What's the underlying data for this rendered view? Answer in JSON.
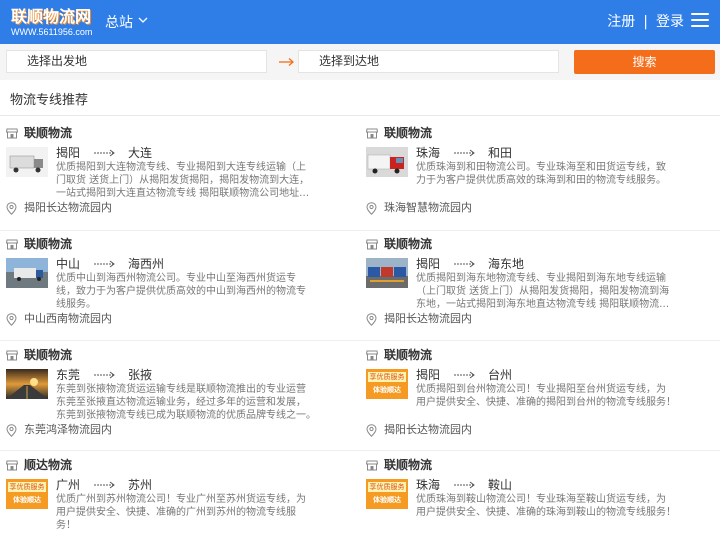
{
  "header": {
    "logo_text": "联顺物流网",
    "logo_url_text": "WWW.5611956.com",
    "station_label": "总站",
    "register_label": "注册",
    "separator": "|",
    "login_label": "登录",
    "brand_color": "#2f7ee8",
    "icons": {
      "station_chevron": "chevron-down-icon",
      "menu": "hamburger-menu-icon"
    }
  },
  "search": {
    "from_placeholder": "选择出发地",
    "to_placeholder": "选择到达地",
    "button_label": "搜索",
    "button_color": "#f46d1a",
    "swap_icon": "arrow-right-icon"
  },
  "section": {
    "title": "物流专线推荐"
  },
  "cards": [
    {
      "company": "联顺物流",
      "from": "揭阳",
      "to": "大连",
      "desc": [
        "优质揭阳到大连物流专线、专业揭阳到大连专线运输（上",
        "门取货 送货上门）从揭阳发货揭阳，揭阳发物流到大连，",
        "一站式揭阳到大连直达物流专线 揭阳联顺物流公司地址…"
      ],
      "location": "揭阳长达物流园内",
      "thumb": "truck-photo"
    },
    {
      "company": "联顺物流",
      "from": "珠海",
      "to": "和田",
      "desc": [
        "优质珠海到和田物流公司。专业珠海至和田货运专线，致",
        "力于为客户提供优质高效的珠海到和田的物流专线服务。"
      ],
      "location": "珠海智慧物流园内",
      "thumb": "red-truck-photo"
    },
    {
      "company": "联顺物流",
      "from": "中山",
      "to": "海西州",
      "desc": [
        "优质中山到海西州物流公司。专业中山至海西州货运专",
        "线，致力于为客户提供优质高效的中山到海西州的物流专",
        "线服务。"
      ],
      "location": "中山西南物流园内",
      "thumb": "highway-truck-photo"
    },
    {
      "company": "联顺物流",
      "from": "揭阳",
      "to": "海东地",
      "desc": [
        "优质揭阳到海东地物流专线、专业揭阳到海东地专线运输",
        "（上门取货 送货上门）从揭阳发货揭阳，揭阳发物流到海",
        "东地，一站式揭阳到海东地直达物流专线 揭阳联顺物流…"
      ],
      "location": "揭阳长达物流园内",
      "thumb": "truck-fleet-photo"
    },
    {
      "company": "联顺物流",
      "from": "东莞",
      "to": "张掖",
      "desc": [
        "东莞到张掖物流货运运输专线是联顺物流推出的专业运营",
        "东莞至张掖直达物流运输业务，经过多年的运营和发展，",
        "东莞到张掖物流专线已成为联顺物流的优质品牌专线之一。"
      ],
      "location": "东莞鸿泽物流园内",
      "thumb": "sunset-road-photo"
    },
    {
      "company": "联顺物流",
      "from": "揭阳",
      "to": "台州",
      "desc": [
        "优质揭阳到台州物流公司！专业揭阳至台州货运专线，为",
        "用户提供安全、快捷、准确的揭阳到台州的物流专线服务！"
      ],
      "location": "揭阳长达物流园内",
      "thumb": "service-banner",
      "banner_top": "享优质服务",
      "banner_bottom": "体验顺达"
    },
    {
      "company": "顺达物流",
      "from": "广州",
      "to": "苏州",
      "desc": [
        "优质广州到苏州物流公司！专业广州至苏州货运专线，为",
        "用户提供安全、快捷、准确的广州到苏州的物流专线服",
        "务！"
      ],
      "location": "",
      "thumb": "service-banner",
      "banner_top": "享优质服务",
      "banner_bottom": "体验顺达"
    },
    {
      "company": "联顺物流",
      "from": "珠海",
      "to": "鞍山",
      "desc": [
        "优质珠海到鞍山物流公司！专业珠海至鞍山货运专线，为",
        "用户提供安全、快捷、准确的珠海到鞍山的物流专线服务！"
      ],
      "location": "",
      "thumb": "service-banner",
      "banner_top": "享优质服务",
      "banner_bottom": "体验顺达"
    }
  ]
}
